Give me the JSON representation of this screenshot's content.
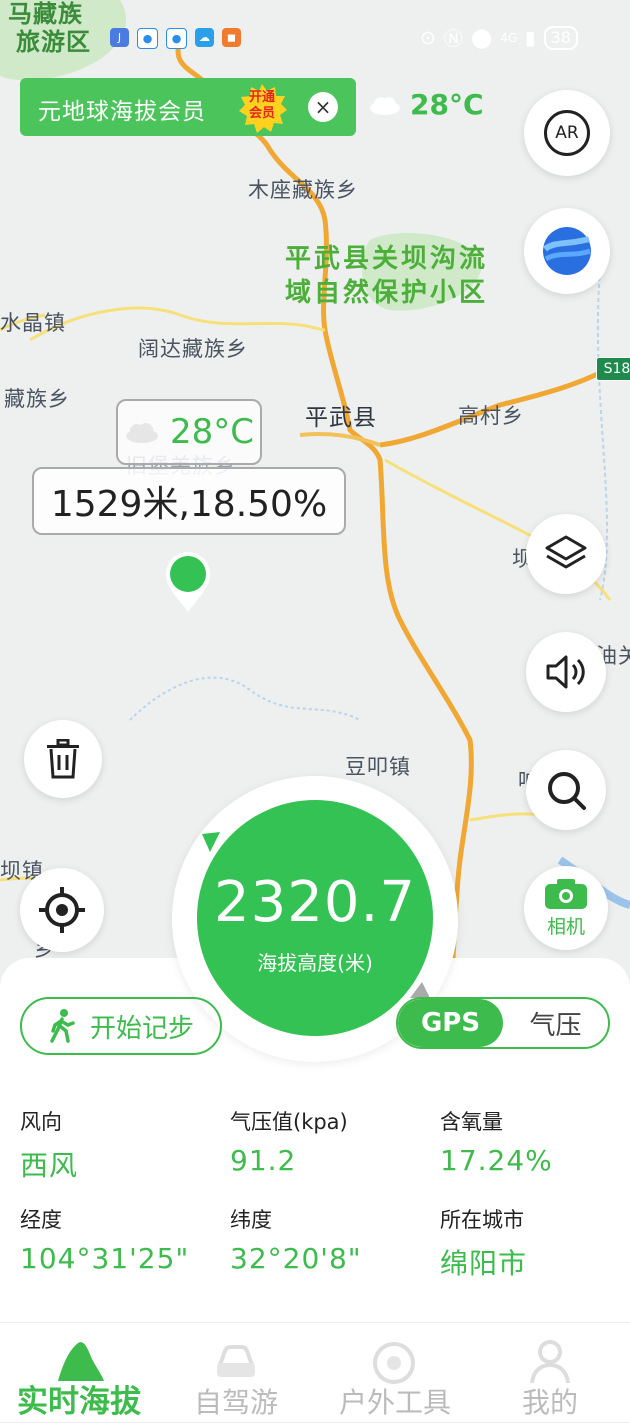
{
  "status_bar": {
    "icons": [
      "jt-icon",
      "app-icon",
      "app-icon",
      "cloud-icon",
      "app-icon"
    ],
    "network": "4G",
    "battery": "38"
  },
  "vip_banner": {
    "text": "元地球海拔会员",
    "badge_line1": "开通",
    "badge_line2": "会员",
    "close": "×"
  },
  "weather_top": {
    "temp": "28°C"
  },
  "map": {
    "labels": {
      "top_left": "马藏族",
      "top_left2": "旅游区",
      "muzuo": "木座藏族乡",
      "shuijing": "水晶镇",
      "kuoda": "阔达藏族乡",
      "zangzu": "藏族乡",
      "pingwu": "平武县",
      "gaocun": "高村乡",
      "jiubao": "旧堡羌族乡",
      "doukou": "豆叩镇",
      "baxiang": "坝镇",
      "right_ba": "坝",
      "right_you": "油关",
      "right_dot": "响",
      "bottom_x": "乡",
      "road_sign": "S18"
    },
    "park": {
      "line1": "平武县关坝沟流",
      "line2": "域自然保护小区"
    }
  },
  "marker": {
    "temp": "28°C",
    "altitude_text": "1529米,18.50%"
  },
  "buttons": {
    "ar": "AR",
    "camera": "相机"
  },
  "altitude": {
    "value": "2320.7",
    "label": "海拔高度(米)"
  },
  "step_button": {
    "label": "开始记步"
  },
  "mode_toggle": {
    "gps": "GPS",
    "pressure": "气压",
    "selected": "GPS"
  },
  "stats": [
    {
      "label": "风向",
      "value": "西风"
    },
    {
      "label": "气压值(kpa)",
      "value": "91.2"
    },
    {
      "label": "含氧量",
      "value": "17.24%"
    },
    {
      "label": "经度",
      "value": "104°31'25\""
    },
    {
      "label": "纬度",
      "value": "32°20'8\""
    },
    {
      "label": "所在城市",
      "value": "绵阳市"
    }
  ],
  "tabs": [
    {
      "label": "实时海拔",
      "active": true
    },
    {
      "label": "自驾游",
      "active": false
    },
    {
      "label": "户外工具",
      "active": false
    },
    {
      "label": "我的",
      "active": false
    }
  ],
  "colors": {
    "accent": "#3dbb4c",
    "road": "#f2b64b",
    "park": "#cfe9c9",
    "water": "#b9d4ec"
  }
}
